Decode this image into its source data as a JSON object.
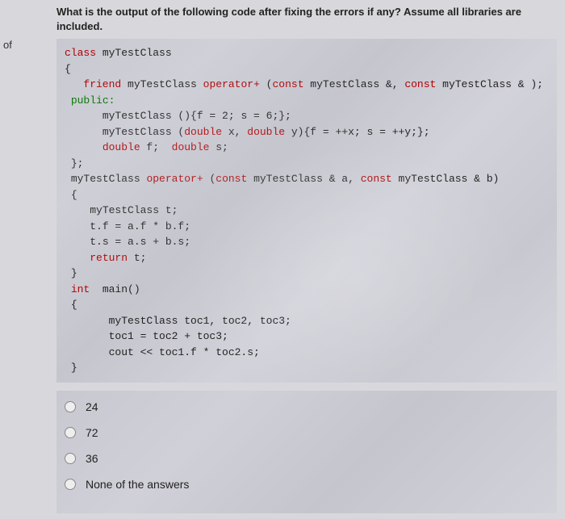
{
  "left_label": "of",
  "question": "What is the output of the following code after fixing the errors if any? Assume all libraries are included.",
  "code": {
    "l1_class": "class",
    "l1_name": "myTestClass",
    "l2": "{",
    "l3_friend": "friend",
    "l3_rest1": "myTestClass ",
    "l3_op": "operator+",
    "l3_rest2": " (",
    "l3_const1": "const",
    "l3_rest3": " myTestClass &, ",
    "l3_const2": "const",
    "l3_rest4": " myTestClass & );",
    "l4_public": "public:",
    "l5": "myTestClass (){f = 2; s = 6;};",
    "l6_a": "myTestClass (",
    "l6_double1": "double",
    "l6_b": " x, ",
    "l6_double2": "double",
    "l6_c": " y){f = ++x; s = ++y;};",
    "l7_double1": "double",
    "l7_a": " f;  ",
    "l7_double2": "double",
    "l7_b": " s;",
    "l8": "};",
    "l9_a": "myTestClass ",
    "l9_op": "operator+",
    "l9_b": " (",
    "l9_const1": "const",
    "l9_c": " myTestClass & a, ",
    "l9_const2": "const",
    "l9_d": " myTestClass & b)",
    "l10": "{",
    "l11": "myTestClass t;",
    "l12": "t.f = a.f * b.f;",
    "l13": "t.s = a.s + b.s;",
    "l14_ret": "return",
    "l14_b": " t;",
    "l15": "}",
    "l16_int": "int",
    "l16_b": "  main()",
    "l17": "{",
    "l18": "myTestClass toc1, toc2, toc3;",
    "l19": "toc1 = toc2 + toc3;",
    "l20": "cout << toc1.f * toc2.s;",
    "l21": "}"
  },
  "answers": [
    {
      "label": "24"
    },
    {
      "label": "72"
    },
    {
      "label": "36"
    },
    {
      "label": "None of the answers"
    }
  ]
}
